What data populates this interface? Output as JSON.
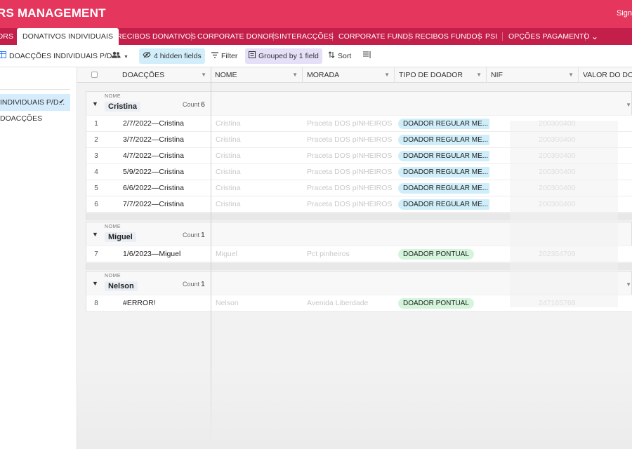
{
  "header": {
    "title": "RS MANAGEMENT",
    "signin": "Sign"
  },
  "tabs": [
    {
      "label": "ORS"
    },
    {
      "label": "DONATIVOS INDIVIDUAIS"
    },
    {
      "label": "RECIBOS DONATIVOS"
    },
    {
      "label": "CORPORATE DONORS"
    },
    {
      "label": "INTERACÇÕES"
    },
    {
      "label": "CORPORATE FUNDS"
    },
    {
      "label": "RECIBOS FUNDOS"
    },
    {
      "label": "PSI"
    },
    {
      "label": "OPÇÕES PAGAMENTO"
    }
  ],
  "toolbar": {
    "view_name": "DOACÇÕES INDIVIDUAIS P/D...",
    "hidden_fields": "4 hidden fields",
    "filter": "Filter",
    "grouped": "Grouped by 1 field",
    "sort": "Sort"
  },
  "sidebar": {
    "items": [
      {
        "label": "INDIVIDUAIS P/D...",
        "active": true
      },
      {
        "label": "DOACÇÕES",
        "active": false
      }
    ]
  },
  "columns": [
    "DOACÇÕES",
    "NOME",
    "MORADA",
    "TIPO DE DOADOR",
    "NIF",
    "VALOR DO DONA"
  ],
  "group_field_label": "NOME",
  "count_label": "Count",
  "groups": [
    {
      "name": "Cristina",
      "count": "6",
      "rows": [
        {
          "num": "1",
          "doacao": "2/7/2022—Cristina",
          "nome": "Cristina",
          "morada": "Praceta DOS pINHEIROS ...",
          "tipo": "DOADOR REGULAR ME...",
          "nif": "200300400"
        },
        {
          "num": "2",
          "doacao": "3/7/2022—Cristina",
          "nome": "Cristina",
          "morada": "Praceta DOS pINHEIROS ...",
          "tipo": "DOADOR REGULAR ME...",
          "nif": "200300400"
        },
        {
          "num": "3",
          "doacao": "4/7/2022—Cristina",
          "nome": "Cristina",
          "morada": "Praceta DOS pINHEIROS ...",
          "tipo": "DOADOR REGULAR ME...",
          "nif": "200300400"
        },
        {
          "num": "4",
          "doacao": "5/9/2022—Cristina",
          "nome": "Cristina",
          "morada": "Praceta DOS pINHEIROS ...",
          "tipo": "DOADOR REGULAR ME...",
          "nif": "200300400"
        },
        {
          "num": "5",
          "doacao": "6/6/2022—Cristina",
          "nome": "Cristina",
          "morada": "Praceta DOS pINHEIROS ...",
          "tipo": "DOADOR REGULAR ME...",
          "nif": "200300400"
        },
        {
          "num": "6",
          "doacao": "7/7/2022—Cristina",
          "nome": "Cristina",
          "morada": "Praceta DOS pINHEIROS ...",
          "tipo": "DOADOR REGULAR ME...",
          "nif": "200300400"
        }
      ]
    },
    {
      "name": "Miguel",
      "count": "1",
      "rows": [
        {
          "num": "7",
          "doacao": "1/6/2023—Miguel",
          "nome": "Miguel",
          "morada": "Pct pinheiros",
          "tipo": "DOADOR PONTUAL",
          "nif": "202354709"
        }
      ]
    },
    {
      "name": "Nelson",
      "count": "1",
      "rows": [
        {
          "num": "8",
          "doacao": "#ERROR!",
          "nome": "Nelson",
          "morada": "Avenida Liberdade",
          "tipo": "DOADOR PONTUAL",
          "nif": "247165768"
        }
      ]
    }
  ],
  "colors": {
    "header": "#e5365e",
    "tabbar": "#c41f4a",
    "pill_regular": "#cfeefa",
    "pill_pontual": "#d4f5dc"
  }
}
